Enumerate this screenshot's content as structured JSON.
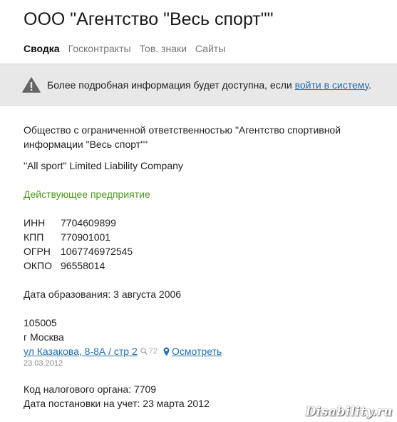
{
  "company": {
    "title": "ООО \"Агентство \"Весь спорт\"\""
  },
  "tabs": [
    {
      "label": "Сводка",
      "active": true
    },
    {
      "label": "Госконтракты",
      "active": false
    },
    {
      "label": "Тов. знаки",
      "active": false
    },
    {
      "label": "Сайты",
      "active": false
    }
  ],
  "notice": {
    "text": "Более подробная информация будет доступна, если ",
    "link_label": "войти в систему",
    "tail": ".",
    "icon": "warning-icon"
  },
  "details": {
    "full_name": "Общество с ограниченной ответственностью \"Агентство спортивной информации \"Весь спорт\"\"",
    "english_name": "\"All sport\" Limited Liability Company",
    "status": "Действующее предприятие",
    "status_color": "#4a9a1c",
    "codes": [
      {
        "label": "ИНН",
        "value": "7704609899"
      },
      {
        "label": "КПП",
        "value": "770901001"
      },
      {
        "label": "ОГРН",
        "value": "1067746972545"
      },
      {
        "label": "ОКПО",
        "value": "96558014"
      }
    ],
    "founded": "Дата образования: 3 августа 2006",
    "address": {
      "postal_code": "105005",
      "city": "г Москва",
      "street_link": "ул Казакова, 8-8А / стр 2",
      "views_count": "72",
      "view_map_label": "Осмотреть",
      "date": "23.03.2012"
    },
    "tax_office": "Код налогового органа: 7709",
    "registration": "Дата постановки на учет: 23 марта 2012"
  },
  "watermark": "Disability.ru",
  "colors": {
    "link": "#1f6fb2",
    "notice_bg": "#e8e8e8"
  }
}
